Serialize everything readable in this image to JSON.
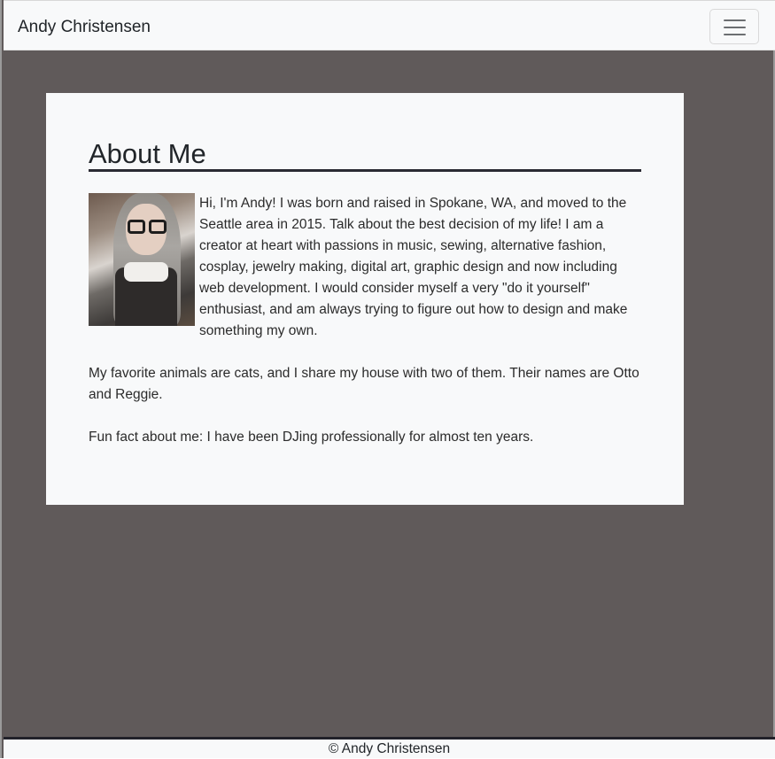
{
  "navbar": {
    "brand": "Andy Christensen",
    "toggle_icon": "hamburger-menu-icon"
  },
  "about": {
    "heading": "About Me",
    "photo_icon": "profile-photo",
    "paragraphs": [
      "Hi, I'm Andy! I was born and raised in Spokane, WA, and moved to the Seattle area in 2015. Talk about the best decision of my life! I am a creator at heart with passions in music, sewing, alternative fashion, cosplay, jewelry making, digital art, graphic design and now including web development. I would consider myself a very \"do it yourself\" enthusiast, and am always trying to figure out how to design and make something my own.",
      "My favorite animals are cats, and I share my house with two of them. Their names are Otto and Reggie.",
      "Fun fact about me: I have been DJing professionally for almost ten years."
    ]
  },
  "footer": {
    "text": "© Andy Christensen"
  },
  "colors": {
    "page_background": "#605a5a",
    "navbar_background": "#f8f9fa",
    "card_background": "#f8f9fa",
    "heading_rule": "#2a2a33"
  }
}
